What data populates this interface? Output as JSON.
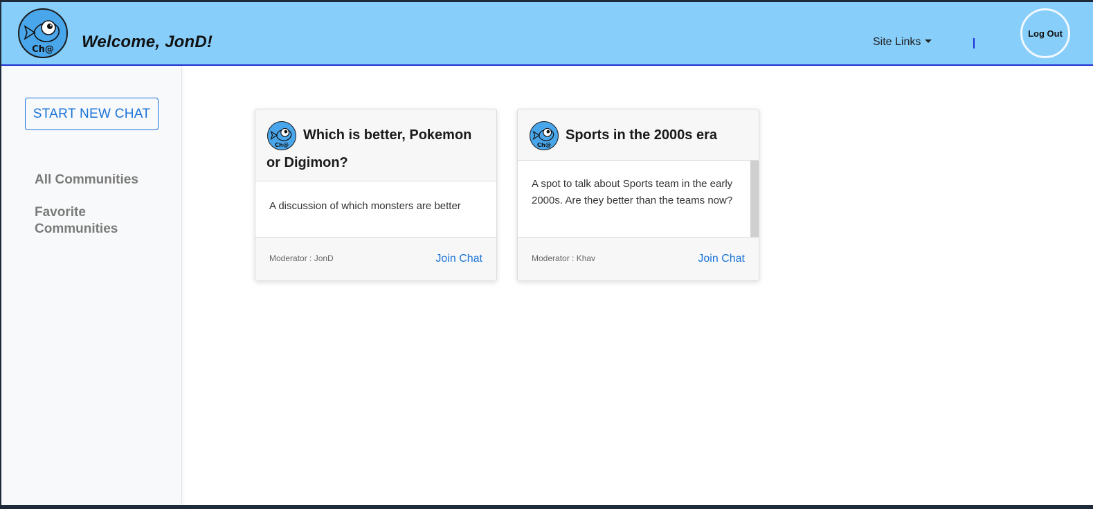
{
  "header": {
    "logo_text": "Ch@",
    "welcome": "Welcome, JonD!",
    "site_links": "Site Links",
    "logout": "Log Out"
  },
  "sidebar": {
    "new_chat": "START NEW CHAT",
    "items": [
      {
        "label": "All Communities"
      },
      {
        "label": "Favorite Communities"
      }
    ]
  },
  "cards": [
    {
      "title": "Which is better, Pokemon or Digimon?",
      "description": "A discussion of which monsters are better",
      "moderator": "Moderator : JonD",
      "action": "Join Chat"
    },
    {
      "title": "Sports in the 2000s era",
      "description": "A spot to talk about Sports team in the early 2000s. Are they better than the teams now?",
      "moderator": "Moderator : Khav",
      "action": "Join Chat"
    }
  ],
  "colors": {
    "topbar": "#87cefa",
    "accent": "#1a73d9",
    "logo_fill": "#4aa6ea"
  },
  "icons": {
    "logo": "fish-chat-logo-icon",
    "dropdown": "caret-down-icon"
  }
}
